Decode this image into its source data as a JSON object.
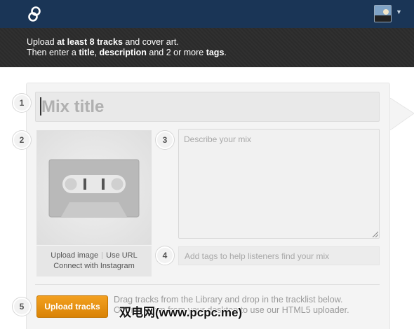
{
  "header": {
    "logo_icon": "link-loop-icon",
    "avatar_icon": "user-avatar-thumbnail",
    "menu_icon": "caret-down-icon"
  },
  "banner": {
    "line1": {
      "t1": "Upload ",
      "b1": "at least 8 tracks",
      "t2": " and cover art."
    },
    "line2": {
      "t1": "Then enter a ",
      "b1": "title",
      "t2": ", ",
      "b2": "description",
      "t3": " and 2 or more ",
      "b3": "tags",
      "t4": "."
    }
  },
  "steps": [
    "1",
    "2",
    "3",
    "4",
    "5"
  ],
  "form": {
    "title_placeholder": "Mix title",
    "art": {
      "icon": "cassette-tape-icon",
      "upload_image": "Upload image",
      "use_url": "Use URL",
      "connect_instagram": "Connect with Instagram"
    },
    "description_placeholder": "Describe your mix",
    "tags_placeholder": "Add tags to help listeners find your mix",
    "upload_button": "Upload tracks",
    "hint_line1": "Drag tracks from the Library and drop in the tracklist below.",
    "hint_line2": "Or drag them from your desktop to use our HTML5 uploader."
  },
  "watermark": "双电网(www.pcpc.me)",
  "colors": {
    "topbar": "#1a3556",
    "banner": "#2b2b2b",
    "accent": "#e8900f"
  }
}
